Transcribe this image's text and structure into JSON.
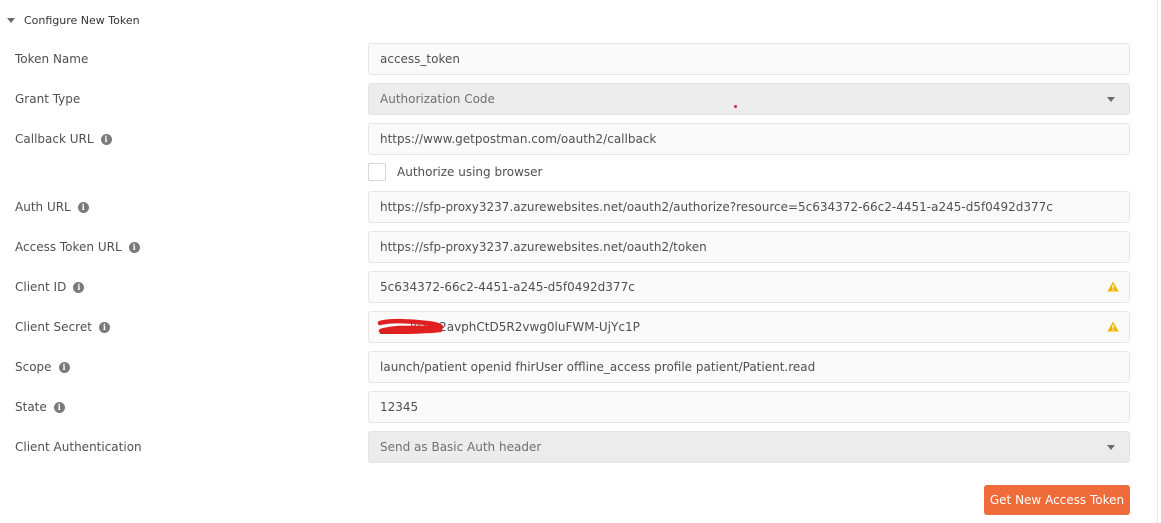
{
  "section": {
    "title": "Configure New Token"
  },
  "fields": {
    "token_name": {
      "label": "Token Name",
      "value": "access_token"
    },
    "grant_type": {
      "label": "Grant Type",
      "value": "Authorization Code"
    },
    "callback_url": {
      "label": "Callback URL",
      "value": "https://www.getpostman.com/oauth2/callback"
    },
    "authorize_browser": {
      "label": "Authorize using browser"
    },
    "auth_url": {
      "label": "Auth URL",
      "value": "https://sfp-proxy3237.azurewebsites.net/oauth2/authorize?resource=5c634372-66c2-4451-a245-d5f0492d377c"
    },
    "access_token_url": {
      "label": "Access Token URL",
      "value": "https://sfp-proxy3237.azurewebsites.net/oauth2/token"
    },
    "client_id": {
      "label": "Client ID",
      "value": "5c634372-66c2-4451-a245-d5f0492d377c"
    },
    "client_secret": {
      "label": "Client Secret",
      "value": "_____kDYu2avphCtD5R2vwg0luFWM-UjYc1P"
    },
    "scope": {
      "label": "Scope",
      "value": "launch/patient openid fhirUser offline_access profile patient/Patient.read"
    },
    "state": {
      "label": "State",
      "value": "12345"
    },
    "client_auth": {
      "label": "Client Authentication",
      "value": "Send as Basic Auth header"
    }
  },
  "actions": {
    "get_token_label": "Get New Access Token"
  },
  "colors": {
    "accent": "#ef6b39",
    "warning": "#f0b400",
    "redaction": "#e02020"
  }
}
